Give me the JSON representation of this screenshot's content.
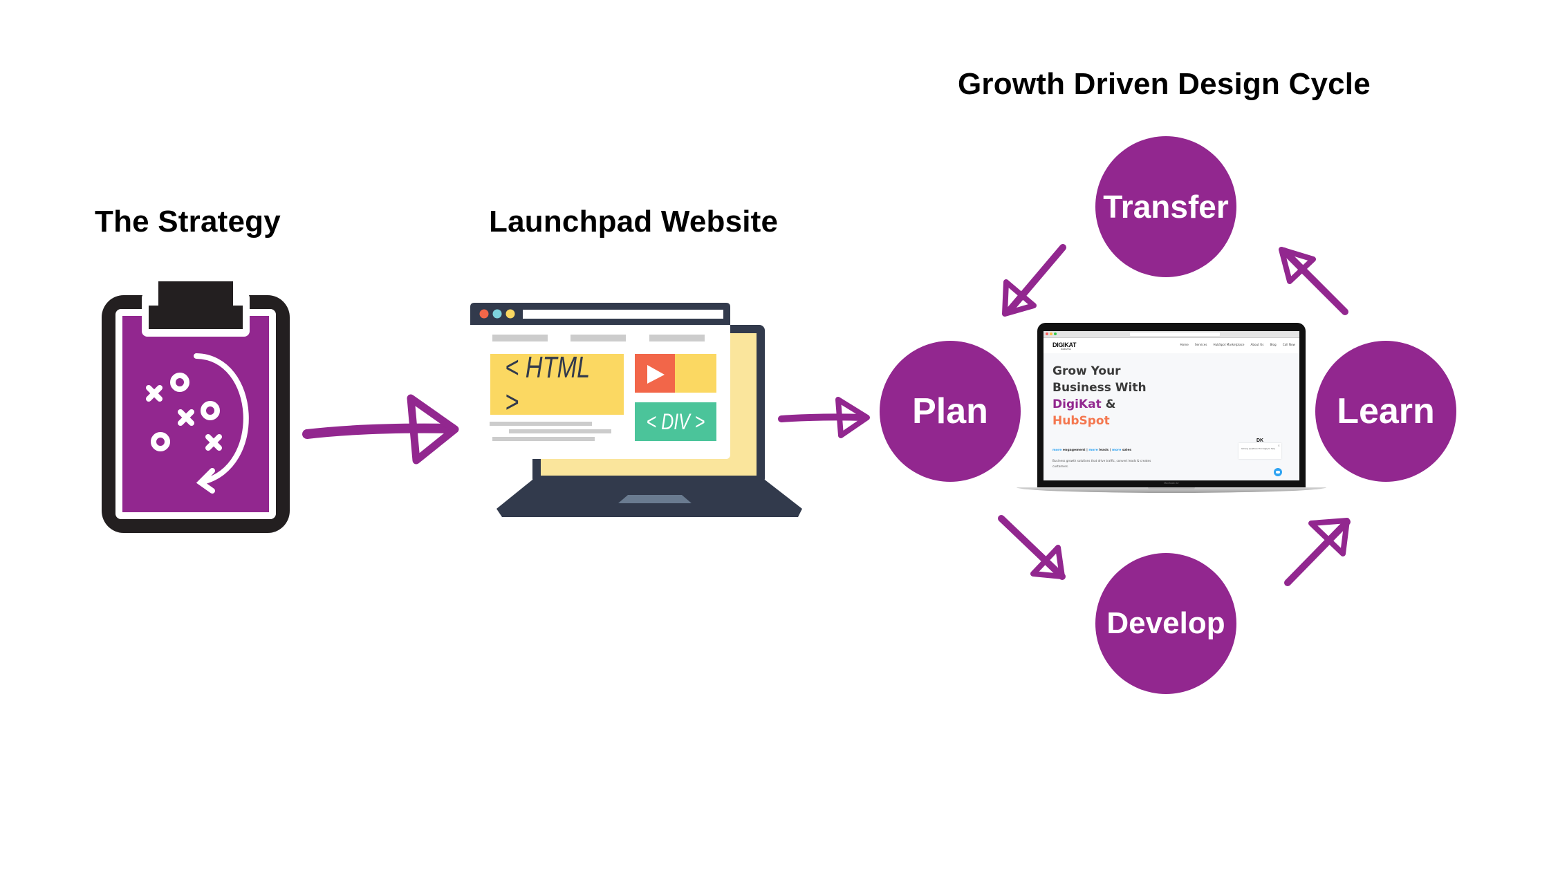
{
  "headings": {
    "strategy": "The Strategy",
    "launchpad": "Launchpad Website",
    "cycle": "Growth Driven Design Cycle"
  },
  "cycle_steps": [
    {
      "label": "Transfer",
      "position": "top"
    },
    {
      "label": "Plan",
      "position": "left"
    },
    {
      "label": "Learn",
      "position": "right"
    },
    {
      "label": "Develop",
      "position": "bottom"
    }
  ],
  "launchpad_illustration": {
    "code_block_1": "< HTML >",
    "code_block_2": "< DIV >",
    "icons": [
      "browser-dots-icon",
      "play-icon"
    ]
  },
  "strategy_illustration": {
    "icons": [
      "clipboard-icon",
      "x-mark-icon",
      "o-mark-icon",
      "curved-arrow-icon"
    ]
  },
  "laptop_mockup": {
    "brand": "DIGIKAT",
    "brand_sub": "MARKETING",
    "nav": [
      "Home",
      "Services",
      "HubSpot Marketplace",
      "About Us",
      "Blog",
      "Call Now"
    ],
    "hero_line_1": "Grow Your",
    "hero_line_2": "Business With",
    "hero_brand_1": "DigiKat",
    "hero_amp": " &",
    "hero_brand_2": "HubSpot",
    "tagline_more": "more",
    "tagline_parts": [
      " engagement | ",
      " leads | ",
      " sales"
    ],
    "description_1": "Business growth solutions that drive traffic, convert leads & creates",
    "description_2": "customers.",
    "chat_logo": "DK",
    "chat_message": "Got any questions? I'm happy to help.",
    "device_label": "MacBook Air"
  },
  "colors": {
    "purple": "#92278f",
    "clipboard_dark": "#231f20",
    "laptop_navy": "#323a4c",
    "yellow": "#fbd862",
    "light_yellow": "#fae59c",
    "red": "#f26649",
    "green": "#4bc49a",
    "hubspot_orange": "#f4774f",
    "link_blue": "#2ea3f2"
  }
}
